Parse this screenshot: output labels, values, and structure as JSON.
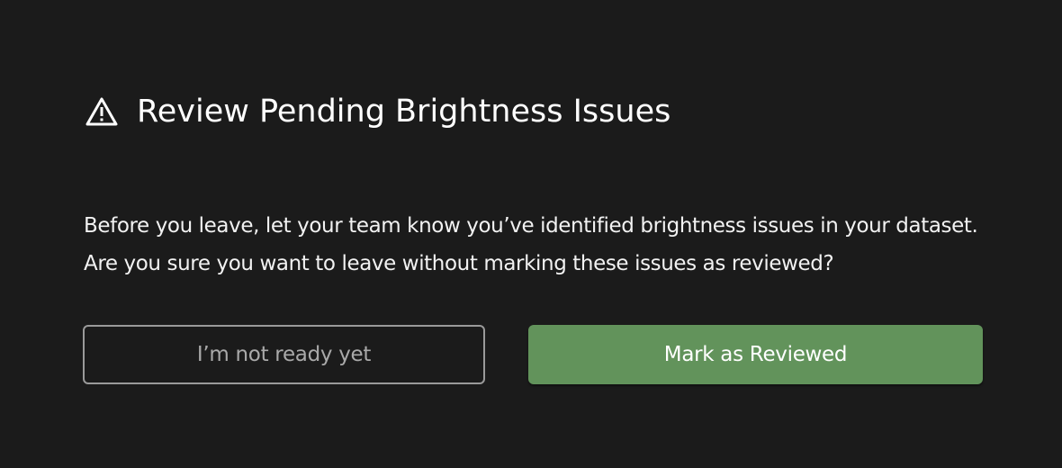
{
  "dialog": {
    "icon": "warning-triangle-icon",
    "title": "Review Pending Brightness Issues",
    "message": "Before you leave, let your team know you’ve identified brightness issues in your dataset. Are you sure you want to leave without marking these issues as reviewed?",
    "secondary_button_label": "I’m not ready yet",
    "primary_button_label": "Mark as Reviewed"
  },
  "colors": {
    "background": "#1b1b1b",
    "primary_button": "#62935b",
    "secondary_border": "#9a9a9a",
    "secondary_text": "#a9a9a9"
  }
}
